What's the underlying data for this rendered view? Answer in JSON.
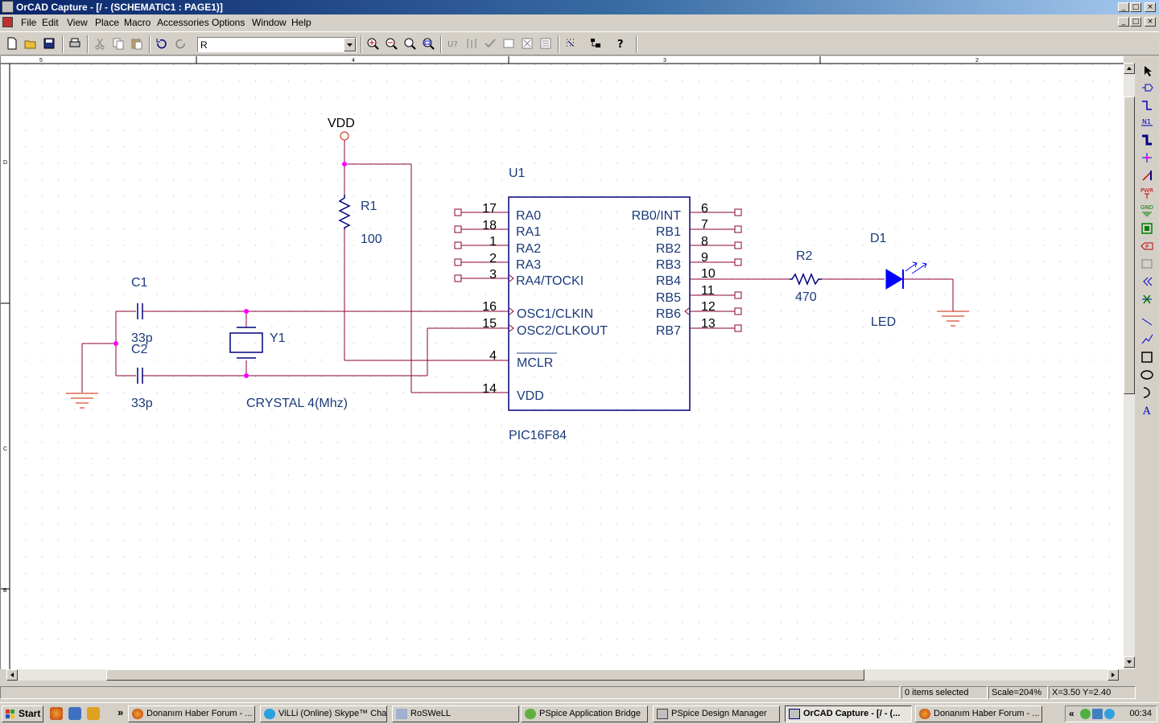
{
  "window": {
    "title": "OrCAD Capture - [/ - (SCHEMATIC1 : PAGE1)]",
    "controls": [
      "_",
      "□",
      "×"
    ]
  },
  "menu": [
    "File",
    "Edit",
    "View",
    "Place",
    "Macro",
    "Accessories",
    "Options",
    "Window",
    "Help"
  ],
  "toolbar": {
    "part_combo_value": "R",
    "buttons": [
      "new-icon",
      "open-icon",
      "save-icon",
      "print-icon",
      "cut-icon",
      "copy-icon",
      "paste-icon",
      "undo-icon",
      "redo-icon",
      "zoom-in-icon",
      "zoom-out-icon",
      "zoom-area-icon",
      "zoom-all-icon",
      "annotate-icon",
      "back-annotate-icon",
      "drc-icon",
      "netlist-icon",
      "cross-reference-icon",
      "bom-icon",
      "snap-to-grid-icon",
      "project-manager-icon",
      "help-icon"
    ]
  },
  "ruler": {
    "top": [
      "5",
      "4",
      "3",
      "2"
    ],
    "left": [
      "D",
      "C",
      "B"
    ]
  },
  "schematic": {
    "vdd_label": "VDD",
    "r1": {
      "ref": "R1",
      "value": "100"
    },
    "r2": {
      "ref": "R2",
      "value": "470"
    },
    "c1": {
      "ref": "C1",
      "value": "33p"
    },
    "c2": {
      "ref": "C2",
      "value": "33p"
    },
    "y1": {
      "ref": "Y1",
      "value": "CRYSTAL 4(Mhz)"
    },
    "d1": {
      "ref": "D1",
      "value": "LED"
    },
    "u1": {
      "ref": "U1",
      "part": "PIC16F84",
      "left_pins": [
        {
          "num": "17",
          "name": "RA0"
        },
        {
          "num": "18",
          "name": "RA1"
        },
        {
          "num": "1",
          "name": "RA2"
        },
        {
          "num": "2",
          "name": "RA3"
        },
        {
          "num": "3",
          "name": "RA4/TOCKI"
        },
        {
          "num": "16",
          "name": "OSC1/CLKIN"
        },
        {
          "num": "15",
          "name": "OSC2/CLKOUT"
        },
        {
          "num": "4",
          "name": "MCLR"
        },
        {
          "num": "14",
          "name": "VDD"
        }
      ],
      "right_pins": [
        {
          "num": "6",
          "name": "RB0/INT"
        },
        {
          "num": "7",
          "name": "RB1"
        },
        {
          "num": "8",
          "name": "RB2"
        },
        {
          "num": "9",
          "name": "RB3"
        },
        {
          "num": "10",
          "name": "RB4"
        },
        {
          "num": "11",
          "name": "RB5"
        },
        {
          "num": "12",
          "name": "RB6"
        },
        {
          "num": "13",
          "name": "RB7"
        }
      ]
    }
  },
  "palette": [
    "select-icon",
    "place-part-icon",
    "place-wire-icon",
    "place-net-alias-icon",
    "place-bus-icon",
    "place-junction-icon",
    "place-bus-entry-icon",
    "place-power-icon",
    "place-ground-icon",
    "place-hierarchical-block-icon",
    "place-port-icon",
    "place-pin-icon",
    "place-off-page-connector-icon",
    "place-no-connect-icon",
    "place-line-icon",
    "place-polyline-icon",
    "place-rectangle-icon",
    "place-ellipse-icon",
    "place-arc-icon",
    "place-text-icon"
  ],
  "status": {
    "selection": "0 items selected",
    "scale": "Scale=204%",
    "coords": "X=3.50  Y=2.40"
  },
  "taskbar": {
    "start_label": "Start",
    "tasks": [
      {
        "label": "Donanım Haber Forum - ...",
        "active": false
      },
      {
        "label": "ViLLi (Online) Skype™ Chat",
        "active": false
      },
      {
        "label": "RoSWeLL",
        "active": false
      },
      {
        "label": "PSpice Application Bridge",
        "active": false
      },
      {
        "label": "PSpice Design Manager",
        "active": false
      },
      {
        "label": "OrCAD Capture - [/ - (...",
        "active": true
      },
      {
        "label": "Donanım Haber Forum - ...",
        "active": false
      }
    ],
    "chevron": "»",
    "tray_chevron": "«",
    "clock": "00:34"
  },
  "colors": {
    "wire": "#8b0036",
    "part": "#000080",
    "text": "#1a3a7a",
    "junction": "#ff00ff",
    "led": "#0000ff",
    "ground": "#cc2200",
    "title_gradient_start": "#0a246a",
    "title_gradient_end": "#a6caf0"
  }
}
